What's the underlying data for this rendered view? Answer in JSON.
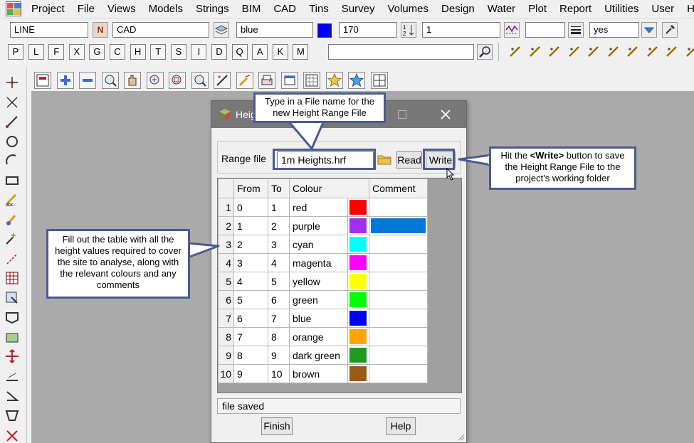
{
  "menu": [
    "Project",
    "File",
    "Views",
    "Models",
    "Strings",
    "BIM",
    "CAD",
    "Tins",
    "Survey",
    "Volumes",
    "Design",
    "Water",
    "Plot",
    "Report",
    "Utilities",
    "User",
    "He"
  ],
  "toolbar": {
    "string_type": "LINE",
    "model_name": "CAD",
    "colour_name": "blue",
    "colour_hex": "#0000ff",
    "weight": "170",
    "line_style": "1",
    "snap_value": "yes",
    "search_value": ""
  },
  "letter_buttons": [
    "P",
    "L",
    "F",
    "X",
    "G",
    "C",
    "H",
    "T",
    "S",
    "I",
    "D",
    "Q",
    "A",
    "K",
    "M"
  ],
  "dialog": {
    "title": "Heig",
    "range_file_label": "Range file",
    "range_file_value": "1m Heights.hrf",
    "read_button": "Read",
    "write_button": "Write",
    "columns": [
      "From",
      "To",
      "Colour",
      "Comment"
    ],
    "rows": [
      {
        "n": "1",
        "from": "0",
        "to": "1",
        "colour": "red",
        "hex": "#ff0000",
        "comment": ""
      },
      {
        "n": "2",
        "from": "1",
        "to": "2",
        "colour": "purple",
        "hex": "#a030f0",
        "comment": ""
      },
      {
        "n": "3",
        "from": "2",
        "to": "3",
        "colour": "cyan",
        "hex": "#00ffff",
        "comment": ""
      },
      {
        "n": "4",
        "from": "3",
        "to": "4",
        "colour": "magenta",
        "hex": "#ff00ff",
        "comment": ""
      },
      {
        "n": "5",
        "from": "4",
        "to": "5",
        "colour": "yellow",
        "hex": "#ffff00",
        "comment": ""
      },
      {
        "n": "6",
        "from": "5",
        "to": "6",
        "colour": "green",
        "hex": "#00ff00",
        "comment": ""
      },
      {
        "n": "7",
        "from": "6",
        "to": "7",
        "colour": "blue",
        "hex": "#0000ff",
        "comment": ""
      },
      {
        "n": "8",
        "from": "7",
        "to": "8",
        "colour": "orange",
        "hex": "#ffa500",
        "comment": ""
      },
      {
        "n": "9",
        "from": "8",
        "to": "9",
        "colour": "dark green",
        "hex": "#1e9b1e",
        "comment": ""
      },
      {
        "n": "10",
        "from": "9",
        "to": "10",
        "colour": "brown",
        "hex": "#9b5a14",
        "comment": ""
      }
    ],
    "status": "file saved",
    "finish_button": "Finish",
    "help_button": "Help"
  },
  "callouts": {
    "file_name": "Type in a File name for the new Height Range File",
    "write_prefix": "Hit the ",
    "write_strong": "<Write>",
    "write_suffix": " button to save the Height Range File to the project's working folder",
    "table": "Fill out the table with all the height values required to cover the site to analyse, along with the relevant colours and any comments"
  },
  "colors": {
    "callout_border": "#4a5b8e",
    "selection": "#0078d7",
    "canvas": "#aaaaaa",
    "titlebar": "#787878"
  }
}
